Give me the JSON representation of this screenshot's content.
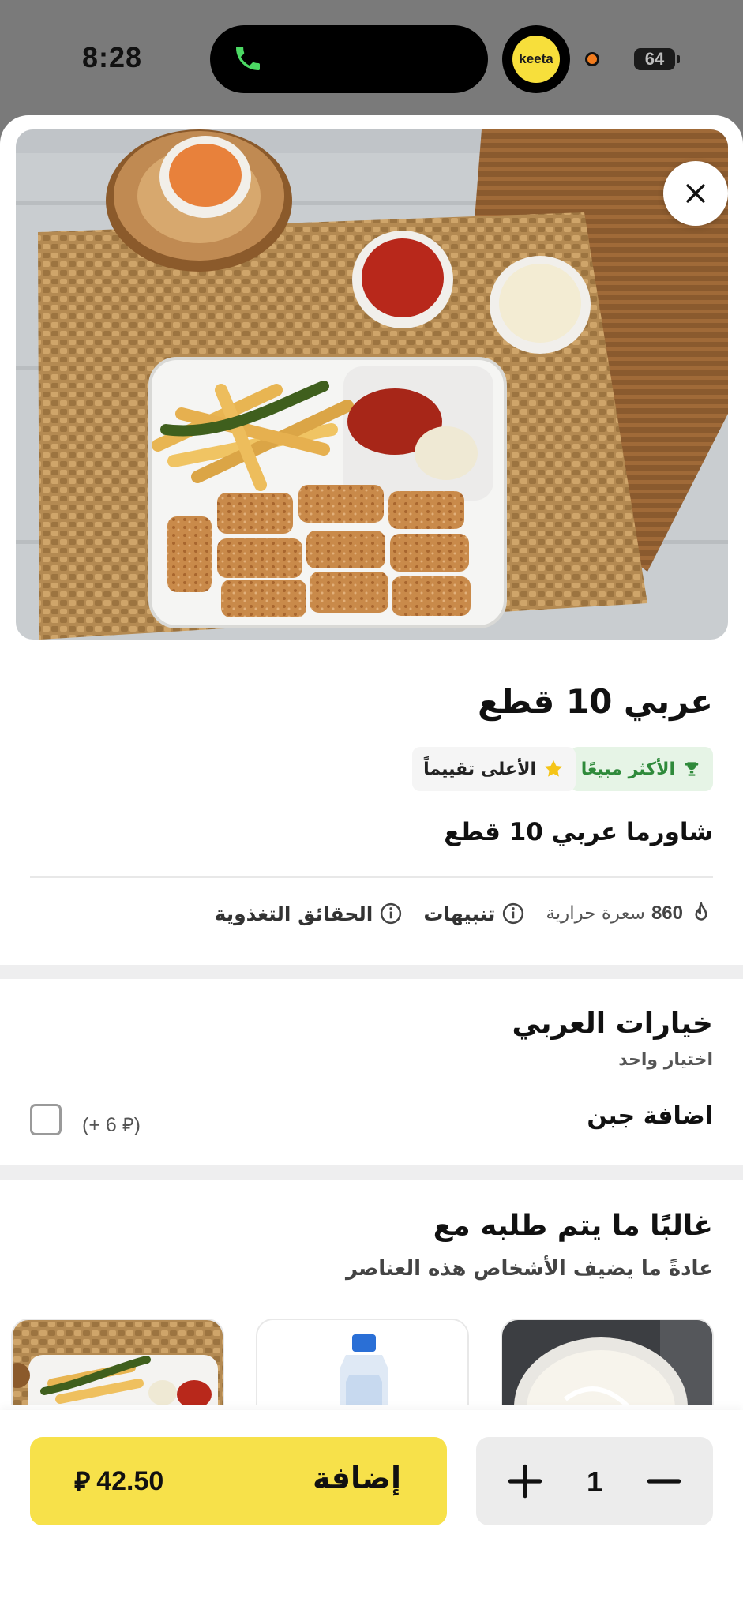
{
  "status_bar": {
    "time": "8:28",
    "app_badge": "keeta",
    "battery": "64"
  },
  "product": {
    "title": "عربي 10 قطع",
    "badges": {
      "best_seller": "الأكثر مبيعًا",
      "top_rated": "الأعلى تقييماً"
    },
    "description": "شاورما عربي 10 قطع",
    "calories_value": "860",
    "calories_label": "سعرة حرارية",
    "alerts_label": "تنبيهات",
    "nutrition_label": "الحقائق التغذوية"
  },
  "options": {
    "title": "خيارات العربي",
    "subtitle": "اختيار واحد",
    "items": [
      {
        "label": "اضافة جبن",
        "price": "(+ 6 ⃁)"
      }
    ]
  },
  "often_ordered": {
    "title": "غالبًا ما يتم طلبه مع",
    "subtitle": "عادةً ما يضيف الأشخاص هذه العناصر"
  },
  "cart": {
    "quantity": "1",
    "add_label": "إضافة",
    "price": "42.50",
    "currency_symbol": "⃁"
  },
  "colors": {
    "accent_yellow": "#f7e14a",
    "best_green": "#2f8a3b",
    "star_yellow": "#f5c518"
  }
}
